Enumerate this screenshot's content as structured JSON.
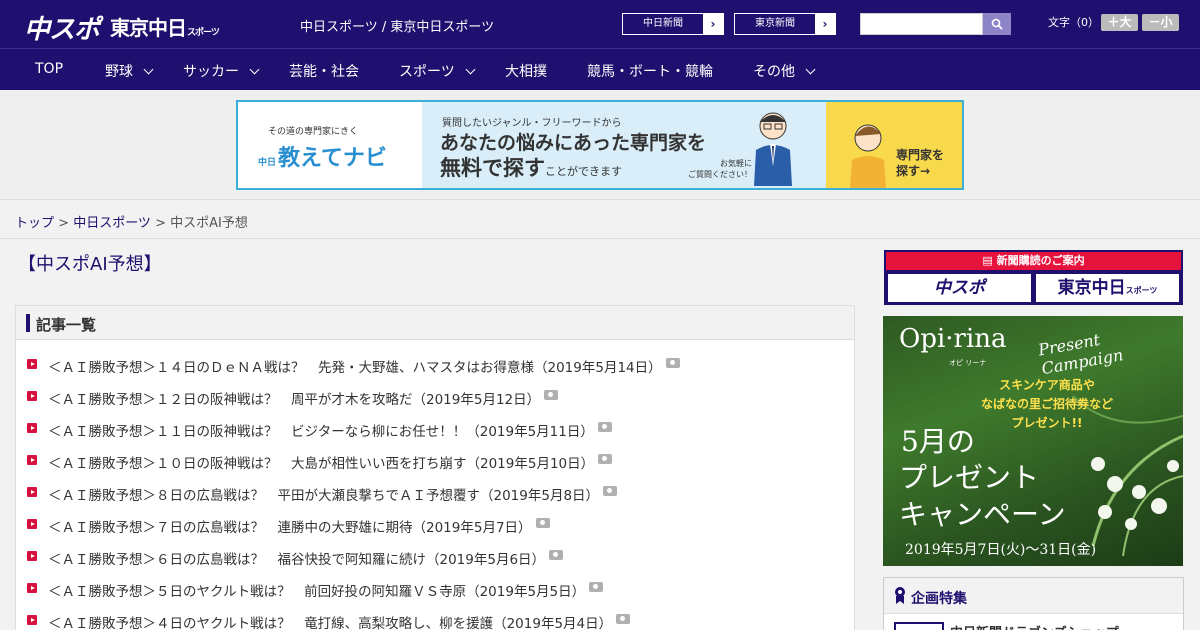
{
  "header": {
    "logo_chuspo": "中スポ",
    "logo_tokyo": "東京中日",
    "logo_tokyo_sub": "スポーツ",
    "site_links": "中日スポーツ / 東京中日スポーツ",
    "pill_chunichi": "中日新聞",
    "pill_tokyo": "東京新聞",
    "search_placeholder": "",
    "text_size_label": "文字（0）",
    "size_up_label": "＋大",
    "size_down_label": "－小"
  },
  "nav": {
    "items": [
      {
        "label": "TOP",
        "has_dropdown": false
      },
      {
        "label": "野球",
        "has_dropdown": true
      },
      {
        "label": "サッカー",
        "has_dropdown": true
      },
      {
        "label": "芸能・社会",
        "has_dropdown": false
      },
      {
        "label": "スポーツ",
        "has_dropdown": true
      },
      {
        "label": "大相撲",
        "has_dropdown": false
      },
      {
        "label": "競馬・ボート・競輪",
        "has_dropdown": false
      },
      {
        "label": "その他",
        "has_dropdown": true
      }
    ]
  },
  "ad_banner": {
    "tagline": "その道の専門家にきく",
    "brand_prefix": "中日",
    "brand": "教えてナビ",
    "line1": "質問したいジャンル・フリーワードから",
    "line2": "あなたの悩みにあった専門家を",
    "line3_main": "無料で探す",
    "line3_tail": "ことができます",
    "note_line1": "お気軽に",
    "note_line2": "ご質問ください！",
    "cta_line1": "専門家を",
    "cta_line2": "探す→",
    "accent_color": "#3ab0d8"
  },
  "breadcrumb": {
    "top": "トップ",
    "sep": " > ",
    "section": "中日スポーツ",
    "current": "中スポAI予想"
  },
  "page": {
    "title": "【中スポAI予想】",
    "list_heading": "記事一覧"
  },
  "articles": [
    "＜ＡＩ勝敗予想＞１４日のＤｅＮＡ戦は？　先発・大野雄、ハマスタはお得意様（2019年5月14日）",
    "＜ＡＩ勝敗予想＞１２日の阪神戦は？　周平が才木を攻略だ（2019年5月12日）",
    "＜ＡＩ勝敗予想＞１１日の阪神戦は？　ビジターなら柳にお任せ！！（2019年5月11日）",
    "＜ＡＩ勝敗予想＞１０日の阪神戦は？　大島が相性いい西を打ち崩す（2019年5月10日）",
    "＜ＡＩ勝敗予想＞８日の広島戦は？　平田が大瀬良撃ちでＡＩ予想覆す（2019年5月8日）",
    "＜ＡＩ勝敗予想＞７日の広島戦は？　連勝中の大野雄に期待（2019年5月7日）",
    "＜ＡＩ勝敗予想＞６日の広島戦は？　福谷快投で阿知羅に続け（2019年5月6日）",
    "＜ＡＩ勝敗予想＞５日のヤクルト戦は？　前回好投の阿知羅ＶＳ寺原（2019年5月5日）",
    "＜ＡＩ勝敗予想＞４日のヤクルト戦は？　竜打線、高梨攻略し、柳を援護（2019年5月4日）"
  ],
  "sidebar": {
    "subscribe_head": "新聞購読のご案内",
    "subscribe_logo1": "中スポ",
    "subscribe_logo2": "東京中日",
    "subscribe_logo2_sub": "スポーツ",
    "promo_brand": "Opi·rina",
    "promo_brand_kana": "オピ リーナ",
    "promo_campaign": "Present Campaign",
    "promo_copy1": "スキンケア商品や",
    "promo_copy2": "なばなの里ご招待券など",
    "promo_copy3": "プレゼント!!",
    "promo_big1": "5月の",
    "promo_big2": "プレゼント",
    "promo_big3": "キャンペーン",
    "promo_dates": "2019年5月7日(火)〜31日(金)",
    "feature_title": "企画特集",
    "feature_item": "中日新聞ドラゴンズショップ"
  },
  "colors": {
    "brand_navy": "#1f0f6e",
    "bullet_red": "#d4103c",
    "subscribe_red": "#e6133c"
  }
}
